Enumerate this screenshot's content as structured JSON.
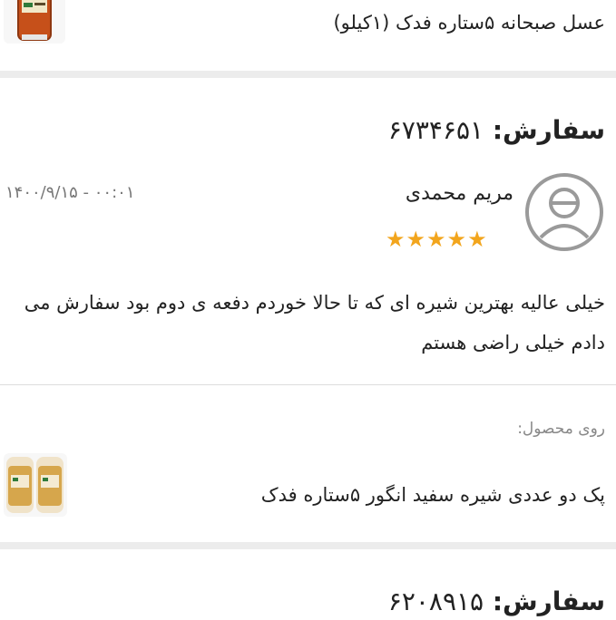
{
  "top_product": {
    "name": "عسل صبحانه ۵ستاره فدک (۱کیلو)",
    "thumb_icon": "honey-jar-icon"
  },
  "review": {
    "order_label": "سفارش:",
    "order_number": "۶۷۳۴۶۵۱",
    "date": "۰۰:۰۱ - ۱۴۰۰/۹/۱۵",
    "reviewer_name": "مریم محمدی",
    "avatar_icon": "user-avatar-icon",
    "rating": 5,
    "rating_max": 5,
    "star_color": "#f2a51d",
    "comment": "خیلی عالیه بهترین شیره ای که تا حالا خوردم دفعه ی دوم بود سفارش می دادم خیلی راضی هستم",
    "on_product_label": "روی محصول:",
    "product_name": "پک دو عددی شیره سفید انگور ۵ستاره فدک",
    "product_thumb_icon": "two-jars-icon"
  },
  "next_review": {
    "order_label": "سفارش:",
    "order_number": "۶۲۰۸۹۱۵"
  }
}
